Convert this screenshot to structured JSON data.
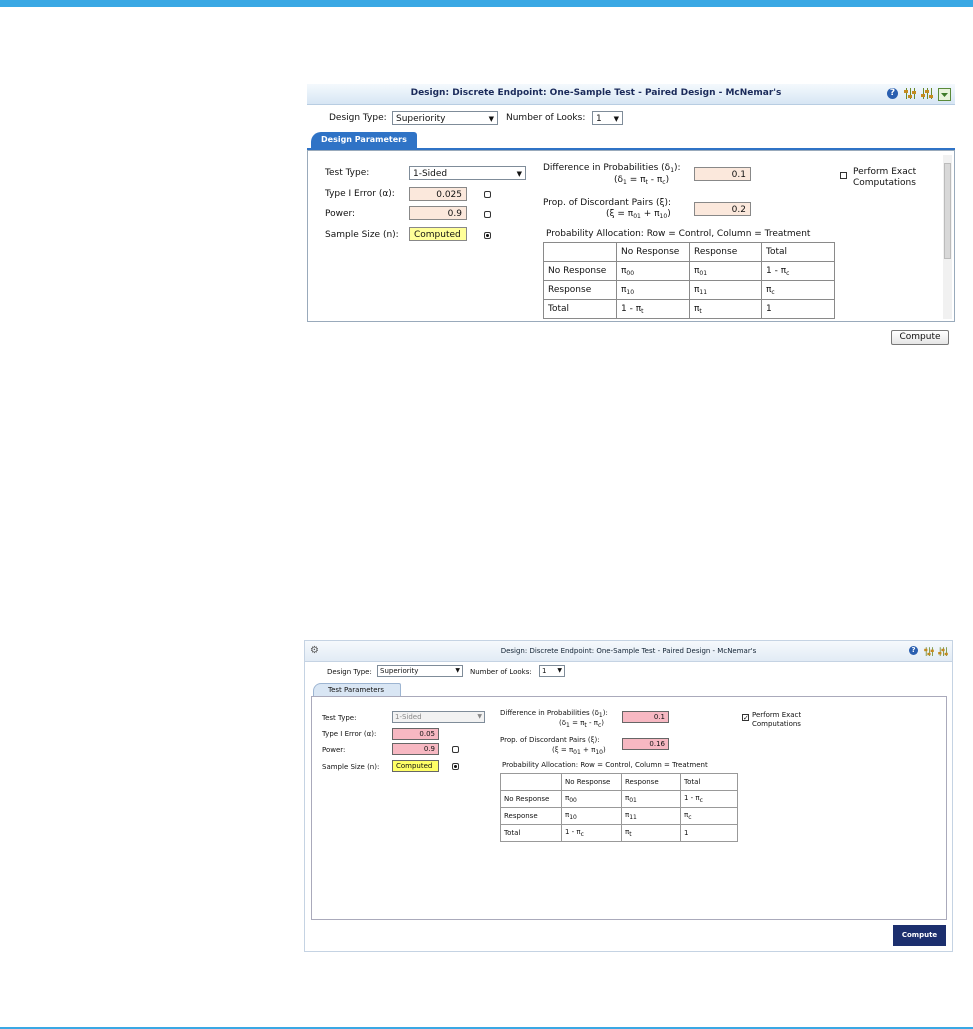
{
  "colors": {
    "accent": "#3aa8e4",
    "tab_blue": "#2f73c6",
    "input_peach": "#fbe8dc",
    "input_pink": "#f7b8c2",
    "computed_yellow": "#ffff99",
    "button_navy": "#1c2f6e"
  },
  "panel1": {
    "title": "Design: Discrete Endpoint: One-Sample Test - Paired Design - McNemar's",
    "header_icons": [
      "help-icon",
      "sliders-icon",
      "sliders-alt-icon",
      "download-icon"
    ],
    "design_type_label": "Design Type:",
    "design_type_value": "Superiority",
    "looks_label": "Number of Looks:",
    "looks_value": "1",
    "tab_label": "Design Parameters",
    "test_type_label": "Test Type:",
    "test_type_value": "1-Sided",
    "alpha_label": "Type I Error (α):",
    "alpha_value": "0.025",
    "power_label": "Power:",
    "power_value": "0.9",
    "n_label": "Sample Size (n):",
    "n_value": "Computed",
    "diff_label": "Difference in Probabilities (δ",
    "diff_label_sub": "1",
    "diff_label_end": "):",
    "diff_formula": "(δ",
    "diff_formula_rest": " = π",
    "diff_formula_rest2": " - π",
    "diff_formula_close": ")",
    "diff_value": "0.1",
    "disc_label": "Prop. of Discordant Pairs (ξ):",
    "disc_formula": "(ξ = π",
    "disc_formula_rest": " + π",
    "disc_formula_close": ")",
    "disc_value": "0.2",
    "exact_label_line1": "Perform Exact",
    "exact_label_line2": "Computations",
    "prob_alloc_caption": "Probability Allocation: Row = Control, Column = Treatment",
    "table_header": [
      "",
      "No Response",
      "Response",
      "Total"
    ],
    "compute_label": "Compute"
  },
  "panel2": {
    "title": "Design: Discrete Endpoint: One-Sample Test - Paired Design - McNemar's",
    "header_icons": [
      "settings-icon",
      "help-icon",
      "sliders-icon",
      "sliders-alt-icon"
    ],
    "design_type_label": "Design Type:",
    "design_type_value": "Superiority",
    "looks_label": "Number of Looks:",
    "looks_value": "1",
    "tab_label": "Test Parameters",
    "test_type_label": "Test Type:",
    "test_type_value": "1-Sided",
    "alpha_label": "Type I Error (α):",
    "alpha_value": "0.05",
    "power_label": "Power:",
    "power_value": "0.9",
    "n_label": "Sample Size (n):",
    "n_value": "Computed",
    "diff_label": "Difference in Probabilities (δ",
    "diff_label_sub": "1",
    "diff_label_end": "):",
    "diff_value": "0.1",
    "disc_label": "Prop. of Discordant Pairs (ξ):",
    "disc_value": "0.16",
    "exact_label_line1": "Perform Exact",
    "exact_label_line2": "Computations",
    "prob_alloc_caption": "Probability Allocation: Row = Control, Column = Treatment",
    "table_header": [
      "",
      "No Response",
      "Response",
      "Total"
    ],
    "compute_label": "Compute"
  },
  "table_rows": {
    "r1": {
      "label": "No Response",
      "c1": "π",
      "c1s": "00",
      "c2": "π",
      "c2s": "01",
      "c3": "1 - π",
      "c3s": "c"
    },
    "r2": {
      "label": "Response",
      "c1": "π",
      "c1s": "10",
      "c2": "π",
      "c2s": "11",
      "c3": "π",
      "c3s": "c"
    },
    "r3": {
      "label": "Total",
      "c1": "1 - π",
      "c1s": "t",
      "c2": "π",
      "c2s": "t",
      "c3": "1"
    }
  },
  "subscripts": {
    "t": "t",
    "c": "c",
    "01": "01",
    "10": "10",
    "one": "1"
  }
}
